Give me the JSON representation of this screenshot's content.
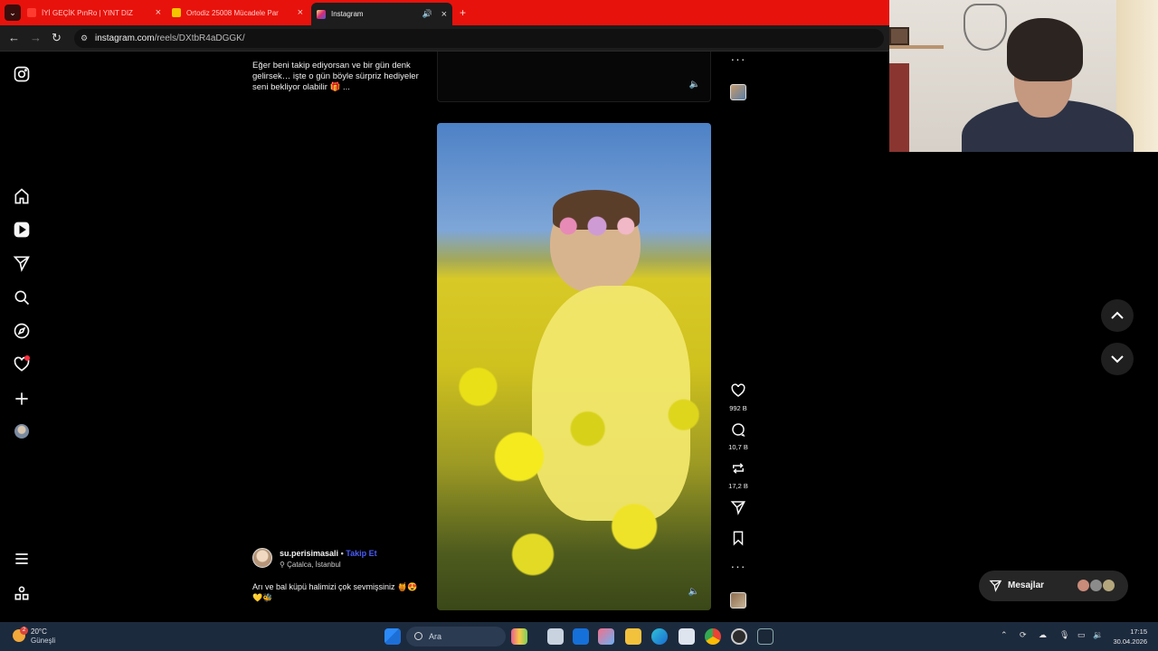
{
  "browser": {
    "tabs": [
      {
        "title": "İYİ GEÇİK PınRo | YINT DIZ",
        "favicon_color": "#ff3b30",
        "active": false
      },
      {
        "title": "Ortodiz 25008 Mücadele Par",
        "favicon_color": "#f5c400",
        "active": false
      },
      {
        "title": "Instagram",
        "favicon_color": "#e1306c",
        "active": true
      }
    ],
    "new_tab_label": "+",
    "url_host": "instagram.com",
    "url_path": "/reels/DXtbR4aDGGK/"
  },
  "reel_previous": {
    "caption": "Eğer beni takip ediyorsan ve bir gün denk gelirsek… işte o gün böyle sürpriz hediyeler seni bekliyor olabilir 🎁 ..."
  },
  "reel_current": {
    "username": "su.perisimasali",
    "separator": "•",
    "follow_label": "Takip Et",
    "location": "Çatalca, İstanbul",
    "caption": "Arı ve bal küpü halimizi çok sevmişsiniz 🍯😍💛🐝",
    "likes": "992 B",
    "comments": "10,7 B",
    "reposts": "17,2 B"
  },
  "messages": {
    "label": "Mesajlar"
  },
  "taskbar": {
    "temperature": "20°C",
    "weather_text": "Güneşli",
    "weather_badge": "2",
    "search_placeholder": "Ara",
    "time": "17:15",
    "date": "30.04.2026"
  },
  "colors": {
    "accent": "#4a5df9",
    "tabbar": "#e8120c",
    "notification": "#ff3040"
  }
}
